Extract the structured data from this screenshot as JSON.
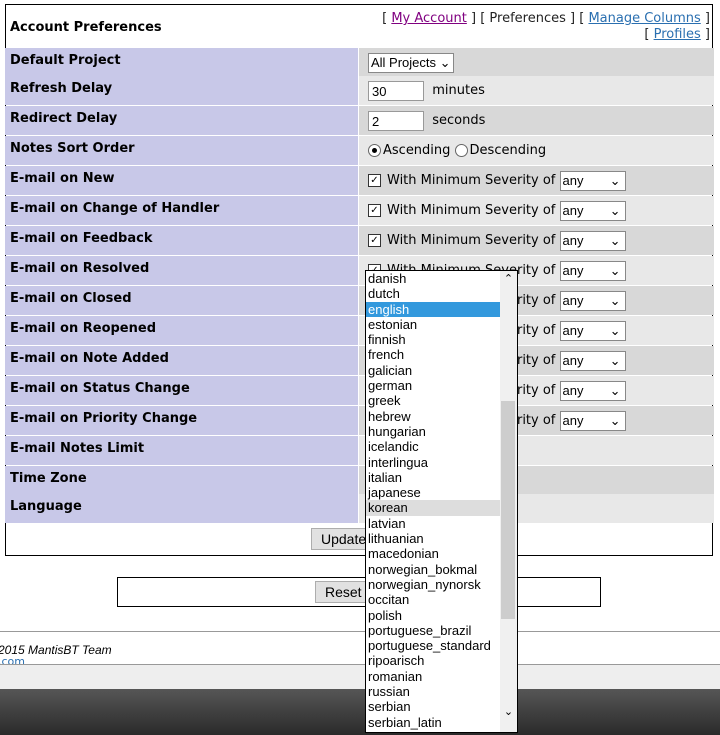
{
  "header": {
    "title": "Account Preferences",
    "nav": [
      {
        "label": "My Account",
        "link": true
      },
      {
        "label": "Preferences",
        "link": false
      },
      {
        "label": "Manage Columns",
        "link": true
      },
      {
        "label": "Profiles",
        "link": true
      }
    ]
  },
  "rows": [
    {
      "label": "Default Project",
      "type": "select",
      "value": "All Projects"
    },
    {
      "label": "Refresh Delay",
      "type": "input",
      "value": "30",
      "unit": "minutes"
    },
    {
      "label": "Redirect Delay",
      "type": "input",
      "value": "2",
      "unit": "seconds"
    },
    {
      "label": "Notes Sort Order",
      "type": "radio",
      "options": [
        "Ascending",
        "Descending"
      ],
      "selected": "Ascending"
    },
    {
      "label": "E-mail on New",
      "type": "email",
      "text": "With Minimum Severity of",
      "value": "any",
      "checked": true
    },
    {
      "label": "E-mail on Change of Handler",
      "type": "email",
      "text": "With Minimum Severity of",
      "value": "any",
      "checked": true
    },
    {
      "label": "E-mail on Feedback",
      "type": "email",
      "text": "With Minimum Severity of",
      "value": "any",
      "checked": true
    },
    {
      "label": "E-mail on Resolved",
      "type": "email",
      "text": "With Minimum Severity of",
      "value": "any",
      "checked": true
    },
    {
      "label": "E-mail on Closed",
      "type": "email",
      "text": "With Minimum Severity of",
      "value": "any",
      "checked": true
    },
    {
      "label": "E-mail on Reopened",
      "type": "email",
      "text": "With Minimum Severity of",
      "value": "any",
      "checked": true
    },
    {
      "label": "E-mail on Note Added",
      "type": "email",
      "text": "With Minimum Severity of",
      "value": "any",
      "checked": true
    },
    {
      "label": "E-mail on Status Change",
      "type": "email",
      "text": "With Minimum Severity of",
      "value": "any",
      "checked": true
    },
    {
      "label": "E-mail on Priority Change",
      "type": "email",
      "text": "With Minimum Severity of",
      "value": "any",
      "checked": true
    },
    {
      "label": "E-mail Notes Limit",
      "type": "blank"
    },
    {
      "label": "Time Zone",
      "type": "blank"
    },
    {
      "label": "Language",
      "type": "blank"
    }
  ],
  "buttons": {
    "update": "Update",
    "reset": "Reset"
  },
  "footer": {
    "copyright": "2015 MantisBT Team",
    "link": ".com"
  },
  "language_dropdown": {
    "selected": "english",
    "hover": "korean",
    "options": [
      "danish",
      "dutch",
      "english",
      "estonian",
      "finnish",
      "french",
      "galician",
      "german",
      "greek",
      "hebrew",
      "hungarian",
      "icelandic",
      "interlingua",
      "italian",
      "japanese",
      "korean",
      "latvian",
      "lithuanian",
      "macedonian",
      "norwegian_bokmal",
      "norwegian_nynorsk",
      "occitan",
      "polish",
      "portuguese_brazil",
      "portuguese_standard",
      "ripoarisch",
      "romanian",
      "russian",
      "serbian",
      "serbian_latin"
    ]
  },
  "colors": {
    "label_bg": "#c8c8e8",
    "row_dark": "#d8d8d8",
    "row_light": "#e8e8e8",
    "selected": "#3399dd"
  }
}
